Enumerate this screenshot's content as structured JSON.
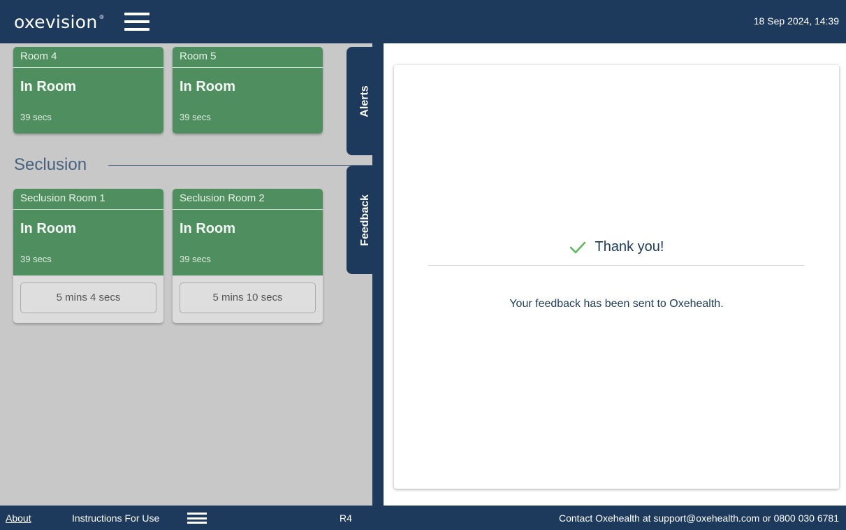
{
  "header": {
    "logo": "oxevision",
    "logo_mark": "®",
    "menu_icon": "hamburger-menu-icon",
    "datetime": "18 Sep 2024, 14:39"
  },
  "rooms": [
    {
      "name": "Room 4",
      "status": "In Room",
      "elapsed": "39 secs"
    },
    {
      "name": "Room 5",
      "status": "In Room",
      "elapsed": "39 secs"
    }
  ],
  "seclusion": {
    "label": "Seclusion",
    "rooms": [
      {
        "name": "Seclusion Room 1",
        "status": "In Room",
        "elapsed": "39 secs",
        "duration": "5 mins 4 secs"
      },
      {
        "name": "Seclusion Room 2",
        "status": "In Room",
        "elapsed": "39 secs",
        "duration": "5 mins 10 secs"
      }
    ]
  },
  "tabs": {
    "alerts": "Alerts",
    "feedback": "Feedback"
  },
  "feedback": {
    "icon": "check-icon",
    "title": "Thank you!",
    "message": "Your feedback has been sent to Oxehealth."
  },
  "footer": {
    "about": "About",
    "instructions": "Instructions For Use",
    "instructions_icon": "hamburger-menu-icon",
    "release": "R4",
    "contact": "Contact Oxehealth at support@oxehealth.com or 0800 030 6781"
  },
  "colors": {
    "navy": "#1d3a5c",
    "status_green": "#4f8f5f",
    "panel_grey": "#c8c8c8",
    "check_green": "#5cb85c"
  }
}
